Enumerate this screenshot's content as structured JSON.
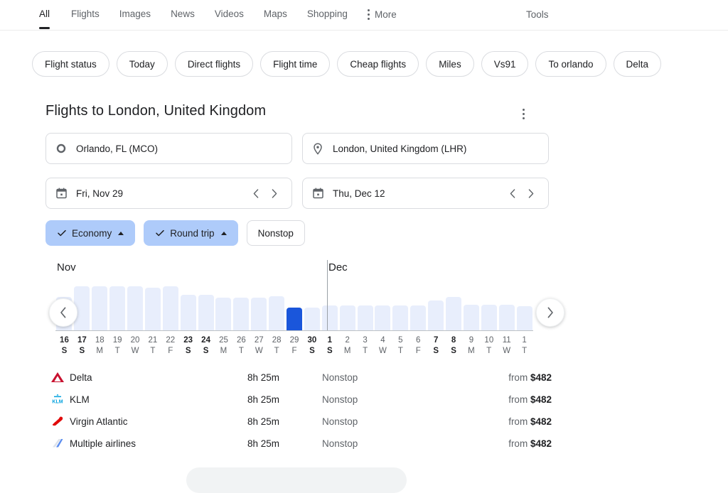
{
  "nav": {
    "tabs": [
      {
        "label": "All",
        "active": true
      },
      {
        "label": "Flights",
        "active": false
      },
      {
        "label": "Images",
        "active": false
      },
      {
        "label": "News",
        "active": false
      },
      {
        "label": "Videos",
        "active": false
      },
      {
        "label": "Maps",
        "active": false
      },
      {
        "label": "Shopping",
        "active": false
      }
    ],
    "more_label": "More",
    "tools_label": "Tools"
  },
  "chips": [
    {
      "label": "Flight status"
    },
    {
      "label": "Today"
    },
    {
      "label": "Direct flights"
    },
    {
      "label": "Flight time"
    },
    {
      "label": "Cheap flights"
    },
    {
      "label": "Miles"
    },
    {
      "label": "Vs91"
    },
    {
      "label": "To orlando"
    },
    {
      "label": "Delta"
    }
  ],
  "module": {
    "title": "Flights to London, United Kingdom",
    "origin": "Orlando, FL (MCO)",
    "destination": "London, United Kingdom (LHR)",
    "depart_date": "Fri, Nov 29",
    "return_date": "Thu, Dec 12",
    "pills": [
      {
        "label": "Economy",
        "selected": true,
        "has_caret": true
      },
      {
        "label": "Round trip",
        "selected": true,
        "has_caret": true
      },
      {
        "label": "Nonstop",
        "selected": false,
        "has_caret": false
      }
    ]
  },
  "chart_data": {
    "type": "bar",
    "title": "",
    "xlabel": "",
    "ylabel": "",
    "months": [
      "Nov",
      "Dec"
    ],
    "month_divider_after_index": 14,
    "selected_index": 13,
    "colors": {
      "bar": "#e8eefc",
      "selected_bar": "#1a56db"
    },
    "categories": [
      {
        "day": "16",
        "dow": "S",
        "bold": true,
        "partial": true
      },
      {
        "day": "17",
        "dow": "S",
        "bold": true,
        "partial": false
      },
      {
        "day": "18",
        "dow": "M",
        "bold": false,
        "partial": false
      },
      {
        "day": "19",
        "dow": "T",
        "bold": false,
        "partial": false
      },
      {
        "day": "20",
        "dow": "W",
        "bold": false,
        "partial": false
      },
      {
        "day": "21",
        "dow": "T",
        "bold": false,
        "partial": false
      },
      {
        "day": "22",
        "dow": "F",
        "bold": false,
        "partial": false
      },
      {
        "day": "23",
        "dow": "S",
        "bold": true,
        "partial": false
      },
      {
        "day": "24",
        "dow": "S",
        "bold": true,
        "partial": false
      },
      {
        "day": "25",
        "dow": "M",
        "bold": false,
        "partial": false
      },
      {
        "day": "26",
        "dow": "T",
        "bold": false,
        "partial": false
      },
      {
        "day": "27",
        "dow": "W",
        "bold": false,
        "partial": false
      },
      {
        "day": "28",
        "dow": "T",
        "bold": false,
        "partial": false
      },
      {
        "day": "29",
        "dow": "F",
        "bold": false,
        "partial": false
      },
      {
        "day": "30",
        "dow": "S",
        "bold": true,
        "partial": false
      },
      {
        "day": "1",
        "dow": "S",
        "bold": true,
        "partial": false
      },
      {
        "day": "2",
        "dow": "M",
        "bold": false,
        "partial": false
      },
      {
        "day": "3",
        "dow": "T",
        "bold": false,
        "partial": false
      },
      {
        "day": "4",
        "dow": "W",
        "bold": false,
        "partial": false
      },
      {
        "day": "5",
        "dow": "T",
        "bold": false,
        "partial": false
      },
      {
        "day": "6",
        "dow": "F",
        "bold": false,
        "partial": false
      },
      {
        "day": "7",
        "dow": "S",
        "bold": true,
        "partial": false
      },
      {
        "day": "8",
        "dow": "S",
        "bold": true,
        "partial": false
      },
      {
        "day": "9",
        "dow": "M",
        "bold": false,
        "partial": false
      },
      {
        "day": "10",
        "dow": "T",
        "bold": false,
        "partial": false
      },
      {
        "day": "11",
        "dow": "W",
        "bold": false,
        "partial": false
      },
      {
        "day": "1",
        "dow": "T",
        "bold": false,
        "partial": true
      }
    ],
    "values": [
      47,
      62,
      62,
      62,
      62,
      60,
      62,
      50,
      50,
      46,
      46,
      46,
      48,
      32,
      32,
      35,
      35,
      35,
      35,
      35,
      35,
      42,
      47,
      36,
      36,
      36,
      34
    ]
  },
  "airlines": {
    "columns": [
      "airline",
      "duration",
      "stops",
      "price"
    ],
    "rows": [
      {
        "name": "Delta",
        "duration": "8h 25m",
        "stops": "Nonstop",
        "price_prefix": "from",
        "price": "$482",
        "logo": "delta-logo"
      },
      {
        "name": "KLM",
        "duration": "8h 25m",
        "stops": "Nonstop",
        "price_prefix": "from",
        "price": "$482",
        "logo": "klm-logo"
      },
      {
        "name": "Virgin Atlantic",
        "duration": "8h 25m",
        "stops": "Nonstop",
        "price_prefix": "from",
        "price": "$482",
        "logo": "virgin-atlantic-logo"
      },
      {
        "name": "Multiple airlines",
        "duration": "8h 25m",
        "stops": "Nonstop",
        "price_prefix": "from",
        "price": "$482",
        "logo": "multiple-airlines-logo"
      }
    ]
  }
}
